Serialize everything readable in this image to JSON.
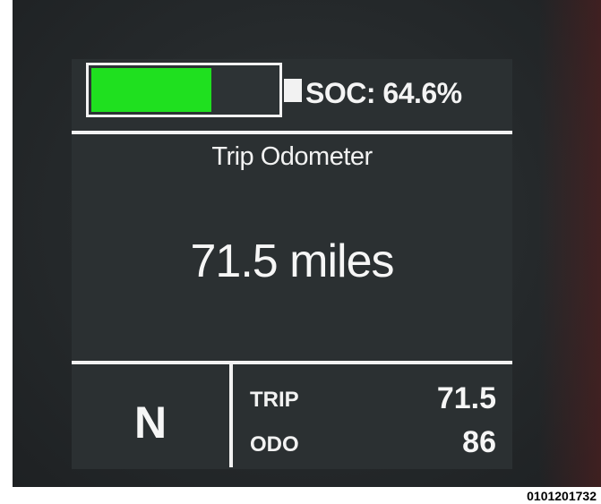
{
  "battery": {
    "soc_text": "SOC: 64.6%",
    "soc_fraction": 0.646,
    "fill_color": "#1fe01f"
  },
  "trip_display": {
    "title": "Trip Odometer",
    "distance": "71.5 miles"
  },
  "status": {
    "gear": "N",
    "trip_label": "TRIP",
    "trip_value": "71.5",
    "odo_label": "ODO",
    "odo_value": "86"
  },
  "image_code": "0101201732"
}
